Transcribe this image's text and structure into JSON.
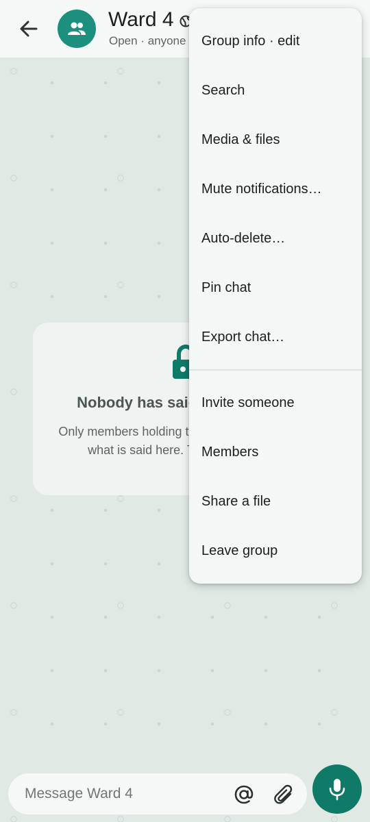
{
  "header": {
    "title": "Ward 4",
    "subtitle": "Open · anyone with the link can join",
    "back_icon": "arrow-left-icon",
    "avatar_icon": "group-icon",
    "status_icon": "globe-icon"
  },
  "empty_state": {
    "icon": "lock-icon",
    "title": "Nobody has said anything yet",
    "body": "Only members holding the group key can read what is said here. The phone relays"
  },
  "menu": {
    "items": [
      "Group info · edit",
      "Search",
      "Media & files",
      "Mute notifications…",
      "Auto-delete…",
      "Pin chat",
      "Export chat…",
      "Invite someone",
      "Members",
      "Share a file",
      "Leave group"
    ]
  },
  "composer": {
    "placeholder": "Message Ward 4",
    "mention_icon": "at-sign-icon",
    "attach_icon": "paperclip-icon",
    "send_icon": "microphone-icon"
  },
  "colors": {
    "accent": "#0f7a68",
    "avatar": "#1c8f7e",
    "chat_background": "#e1e9e5",
    "menu_background": "#f3f7f5"
  }
}
